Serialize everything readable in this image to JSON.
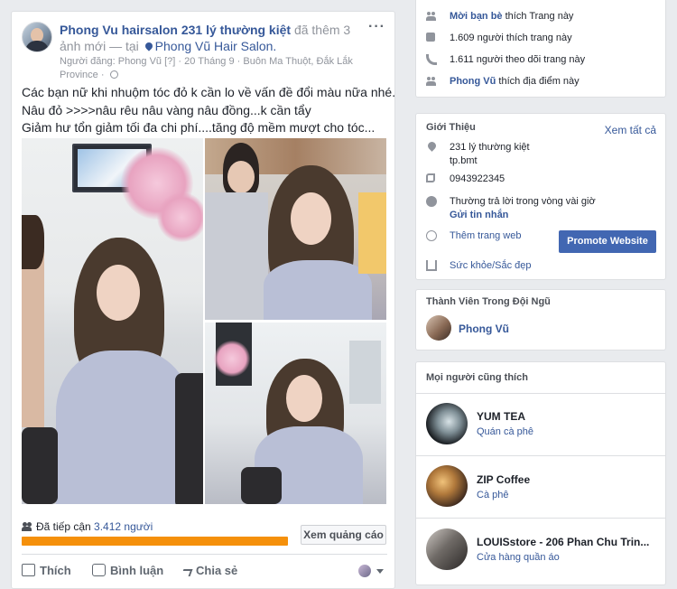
{
  "post": {
    "author": "Phong Vu hairsalon 231 lý thường kiệt",
    "action": "đã thêm 3 ảnh mới",
    "at_sep": "— tại",
    "place": "Phong Vũ Hair Salon.",
    "meta_prefix": "Người đăng:",
    "poster": "Phong Vũ",
    "poster_mark": "[?]",
    "date": "20 Tháng 9",
    "location": "Buôn Ma Thuột, Đắk Lắk Province",
    "lines": [
      "Các bạn nữ khi nhuộm tóc đỏ k cần lo về vấn đề đổi màu nữa nhé...",
      "Nâu đỏ >>>>nâu rêu nâu vàng nâu đồng...k cần tẩy",
      "Giảm hư tổn giảm tối đa chi phí....tăng độ mềm mượt cho tóc..."
    ],
    "reach_label": "Đã tiếp cận",
    "reach_count": "3.412 người",
    "reach_progress": 1.0,
    "ads_button": "Xem quảng cáo",
    "like": "Thích",
    "comment": "Bình luận",
    "share": "Chia sẻ"
  },
  "sidebar": {
    "top_rows": [
      {
        "strong": "Mời bạn bè",
        "rest": "thích Trang này"
      },
      {
        "strong": "",
        "rest": "1.609 người thích trang này"
      },
      {
        "strong": "",
        "rest": "1.611 người theo dõi trang này"
      },
      {
        "strong": "Phong Vũ",
        "rest": "thích địa điểm này"
      }
    ],
    "about": {
      "title": "Giới Thiệu",
      "see_all": "Xem tất cả",
      "address_1": "231 lý thường kiệt",
      "address_2": "tp.bmt",
      "phone": "0943922345",
      "response": "Thường trả lời trong vòng vài giờ",
      "send_message": "Gửi tin nhắn",
      "add_website": "Thêm trang web",
      "promote": "Promote Website",
      "category": "Sức khỏe/Sắc đẹp"
    },
    "team": {
      "title": "Thành Viên Trong Đội Ngũ",
      "member": "Phong Vũ"
    },
    "also_like": {
      "title": "Mọi người cũng thích",
      "pages": [
        {
          "name": "YUM TEA",
          "category": "Quán cà phê"
        },
        {
          "name": "ZIP Coffee",
          "category": "Cà phê"
        },
        {
          "name": "LOUISstore - 206 Phan Chu Trin...",
          "category": "Cửa hàng quần áo"
        }
      ]
    }
  }
}
